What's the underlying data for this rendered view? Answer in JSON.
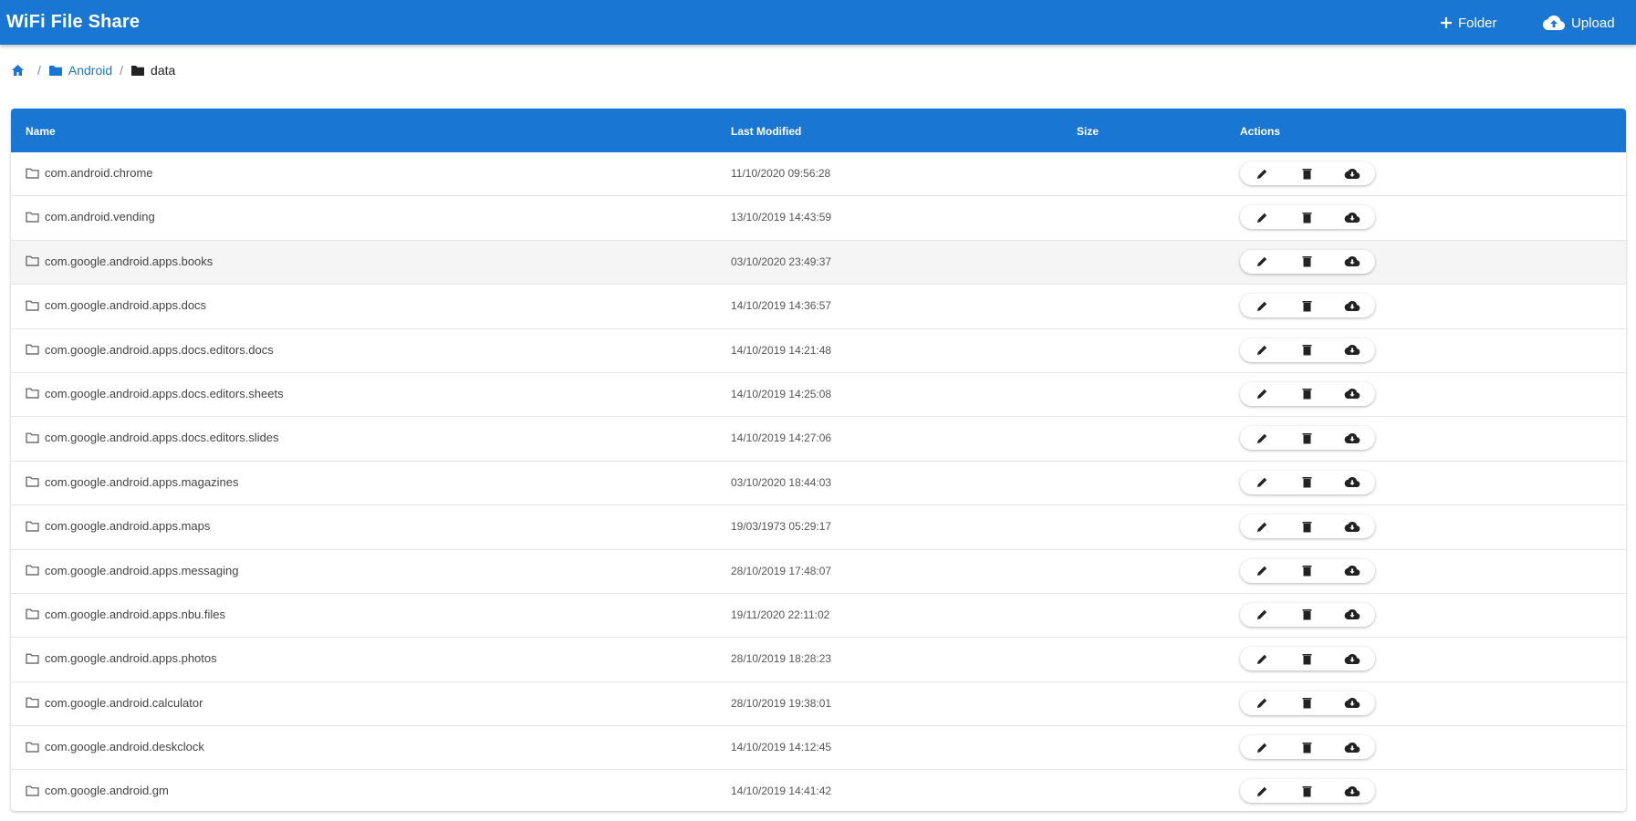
{
  "app": {
    "title": "WiFi File Share",
    "folder_label": "Folder",
    "upload_label": "Upload",
    "accent": "#1976d2"
  },
  "breadcrumb": {
    "home_icon": "home-icon",
    "items": [
      {
        "label": "Android",
        "icon": "folder-icon"
      },
      {
        "label": "data",
        "icon": "folder-icon"
      }
    ]
  },
  "table": {
    "headers": {
      "name": "Name",
      "modified": "Last Modified",
      "size": "Size",
      "actions": "Actions"
    },
    "rows": [
      {
        "name": "com.android.chrome",
        "modified": "11/10/2020 09:56:28"
      },
      {
        "name": "com.android.vending",
        "modified": "13/10/2019 14:43:59"
      },
      {
        "name": "com.google.android.apps.books",
        "modified": "03/10/2020 23:49:37"
      },
      {
        "name": "com.google.android.apps.docs",
        "modified": "14/10/2019 14:36:57"
      },
      {
        "name": "com.google.android.apps.docs.editors.docs",
        "modified": "14/10/2019 14:21:48"
      },
      {
        "name": "com.google.android.apps.docs.editors.sheets",
        "modified": "14/10/2019 14:25:08"
      },
      {
        "name": "com.google.android.apps.docs.editors.slides",
        "modified": "14/10/2019 14:27:06"
      },
      {
        "name": "com.google.android.apps.magazines",
        "modified": "03/10/2020 18:44:03"
      },
      {
        "name": "com.google.android.apps.maps",
        "modified": "19/03/1973 05:29:17"
      },
      {
        "name": "com.google.android.apps.messaging",
        "modified": "28/10/2019 17:48:07"
      },
      {
        "name": "com.google.android.apps.nbu.files",
        "modified": "19/11/2020 22:11:02"
      },
      {
        "name": "com.google.android.apps.photos",
        "modified": "28/10/2019 18:28:23"
      },
      {
        "name": "com.google.android.calculator",
        "modified": "28/10/2019 19:38:01"
      },
      {
        "name": "com.google.android.deskclock",
        "modified": "14/10/2019 14:12:45"
      },
      {
        "name": "com.google.android.gm",
        "modified": "14/10/2019 14:41:42"
      }
    ],
    "row_actions": [
      "edit-icon",
      "delete-icon",
      "cloud-download-icon"
    ],
    "highlighted_row": 2
  }
}
